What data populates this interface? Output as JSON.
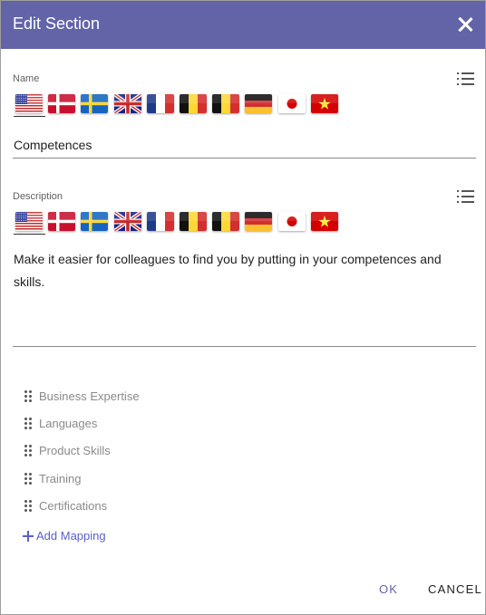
{
  "dialog": {
    "title": "Edit Section",
    "close_icon": "close-icon"
  },
  "name_field": {
    "label": "Name",
    "value": "Competences",
    "menu_icon": "list-icon"
  },
  "description_field": {
    "label": "Description",
    "value": "Make it easier for colleagues to find you by putting in your competences and skills.",
    "menu_icon": "list-icon"
  },
  "languages": [
    "us",
    "dk",
    "se",
    "gb",
    "fr",
    "be",
    "be",
    "de",
    "jp",
    "vn"
  ],
  "selected_language": "us",
  "mappings": [
    {
      "label": "Business Expertise"
    },
    {
      "label": "Languages"
    },
    {
      "label": "Product Skills"
    },
    {
      "label": "Training"
    },
    {
      "label": "Certifications"
    }
  ],
  "add_mapping_label": "Add Mapping",
  "actions": {
    "ok_label": "OK",
    "cancel_label": "CANCEL"
  },
  "colors": {
    "header": "#6264a7",
    "accent": "#5b5fc7"
  }
}
